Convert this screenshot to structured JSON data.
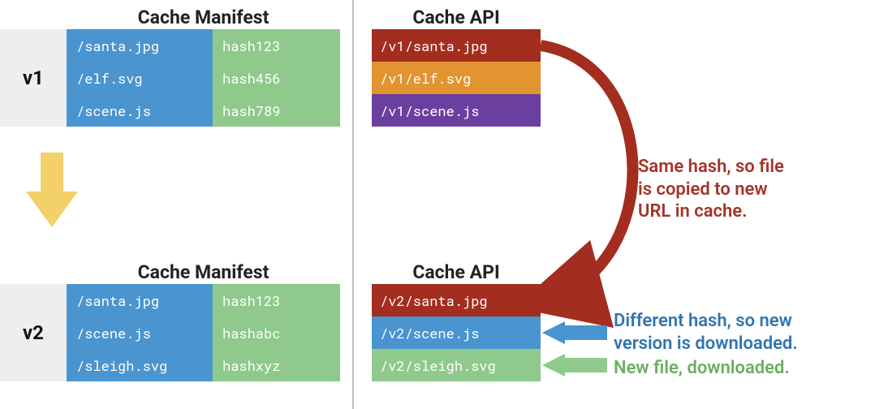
{
  "headings": {
    "manifest1": "Cache Manifest",
    "manifest2": "Cache Manifest",
    "api1": "Cache API",
    "api2": "Cache API"
  },
  "v1": {
    "label": "v1",
    "files": [
      "/santa.jpg",
      "/elf.svg",
      "/scene.js"
    ],
    "hashes": [
      "hash123",
      "hash456",
      "hash789"
    ]
  },
  "v2": {
    "label": "v2",
    "files": [
      "/santa.jpg",
      "/scene.js",
      "/sleigh.svg"
    ],
    "hashes": [
      "hash123",
      "hashabc",
      "hashxyz"
    ]
  },
  "cache_v1": [
    "/v1/santa.jpg",
    "/v1/elf.svg",
    "/v1/scene.js"
  ],
  "cache_v2": [
    "/v2/santa.jpg",
    "/v2/scene.js",
    "/v2/sleigh.svg"
  ],
  "annotations": {
    "same_hash": "Same hash, so file\nis copied to new\nURL in cache.",
    "diff_hash": "Different hash, so new\nversion is downloaded.",
    "new_file": "New file, downloaded."
  },
  "colors": {
    "red": "#a32d1f",
    "orange": "#e29431",
    "purple": "#6b3fa0",
    "blue": "#4a94d0",
    "green": "#8fc98c",
    "yellow": "#f4d06a"
  }
}
